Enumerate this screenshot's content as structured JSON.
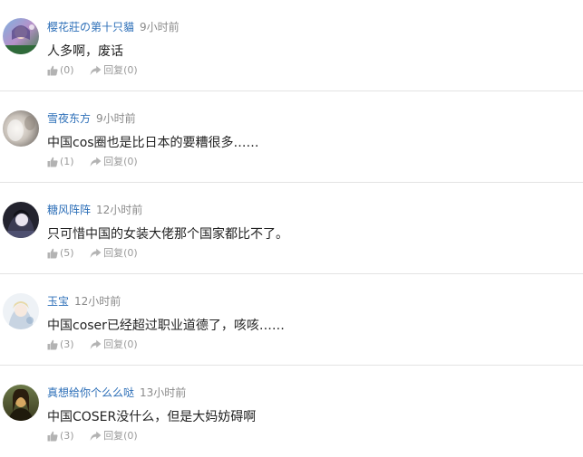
{
  "comments": [
    {
      "username": "樱花莊の第十只貓",
      "time": "9小时前",
      "text": "人多啊，废话",
      "likes": "(0)",
      "reply_label": "回复",
      "reply_count": "(0)",
      "avatar": "anime-girl-avatar"
    },
    {
      "username": "雪夜东方",
      "time": "9小时前",
      "text": "中国cos圈也是比日本的要糟很多……",
      "likes": "(1)",
      "reply_label": "回复",
      "reply_count": "(0)",
      "avatar": "blurred-photo-avatar"
    },
    {
      "username": "糖风阵阵",
      "time": "12小时前",
      "text": "只可惜中国的女装大佬那个国家都比不了。",
      "likes": "(5)",
      "reply_label": "回复",
      "reply_count": "(0)",
      "avatar": "dark-anime-avatar"
    },
    {
      "username": "玉宝",
      "time": "12小时前",
      "text": "中国coser已经超过职业道德了，咳咳……",
      "likes": "(3)",
      "reply_label": "回复",
      "reply_count": "(0)",
      "avatar": "light-anime-avatar"
    },
    {
      "username": "真想给你个么么哒",
      "time": "13小时前",
      "text": "中国COSER没什么，但是大妈妨碍啊",
      "likes": "(3)",
      "reply_label": "回复",
      "reply_count": "(0)",
      "avatar": "mona-lisa-avatar"
    }
  ],
  "colors": {
    "username": "#2d6fb8",
    "time": "#8a8a8a",
    "content": "#222222",
    "actions": "#9a9a9a",
    "separator": "#e3e3e3"
  }
}
